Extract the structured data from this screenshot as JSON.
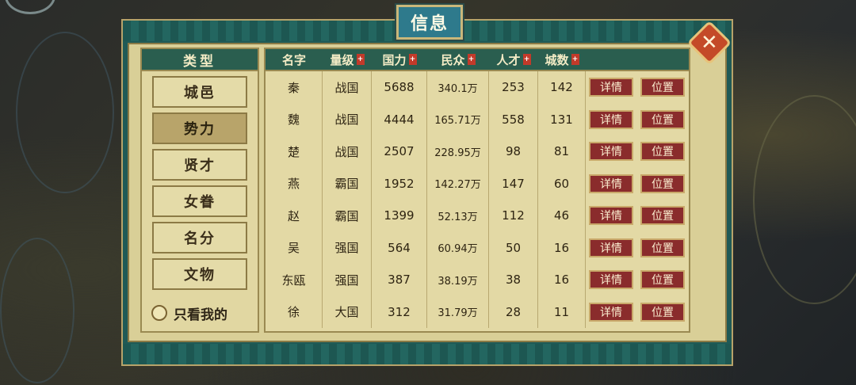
{
  "window": {
    "title": "信息"
  },
  "sidebar": {
    "header": "类型",
    "items": [
      {
        "label": "城邑",
        "active": false
      },
      {
        "label": "势力",
        "active": true
      },
      {
        "label": "贤才",
        "active": false
      },
      {
        "label": "女眷",
        "active": false
      },
      {
        "label": "名分",
        "active": false
      },
      {
        "label": "文物",
        "active": false
      }
    ],
    "filter_label": "只看我的"
  },
  "table": {
    "columns": [
      {
        "label": "名字",
        "sortable": false,
        "sort_icon": ""
      },
      {
        "label": "量级",
        "sortable": true,
        "sort_icon": "+"
      },
      {
        "label": "国力",
        "sortable": true,
        "sort_icon": "+"
      },
      {
        "label": "民众",
        "sortable": true,
        "sort_icon": "+"
      },
      {
        "label": "人才",
        "sortable": true,
        "sort_icon": "+"
      },
      {
        "label": "城数",
        "sortable": true,
        "sort_icon": "+"
      }
    ],
    "detail_label": "详情",
    "locate_label": "位置",
    "rows": [
      {
        "name": "秦",
        "rank": "战国",
        "power": "5688",
        "population": "340.1万",
        "talent": "253",
        "cities": "142"
      },
      {
        "name": "魏",
        "rank": "战国",
        "power": "4444",
        "population": "165.71万",
        "talent": "558",
        "cities": "131"
      },
      {
        "name": "楚",
        "rank": "战国",
        "power": "2507",
        "population": "228.95万",
        "talent": "98",
        "cities": "81"
      },
      {
        "name": "燕",
        "rank": "霸国",
        "power": "1952",
        "population": "142.27万",
        "talent": "147",
        "cities": "60"
      },
      {
        "name": "赵",
        "rank": "霸国",
        "power": "1399",
        "population": "52.13万",
        "talent": "112",
        "cities": "46"
      },
      {
        "name": "吴",
        "rank": "强国",
        "power": "564",
        "population": "60.94万",
        "talent": "50",
        "cities": "16"
      },
      {
        "name": "东瓯",
        "rank": "强国",
        "power": "387",
        "population": "38.19万",
        "talent": "38",
        "cities": "16"
      },
      {
        "name": "徐",
        "rank": "大国",
        "power": "312",
        "population": "31.79万",
        "talent": "28",
        "cities": "11"
      }
    ]
  },
  "close": {
    "icon": "close-icon",
    "glyph": "✕"
  }
}
